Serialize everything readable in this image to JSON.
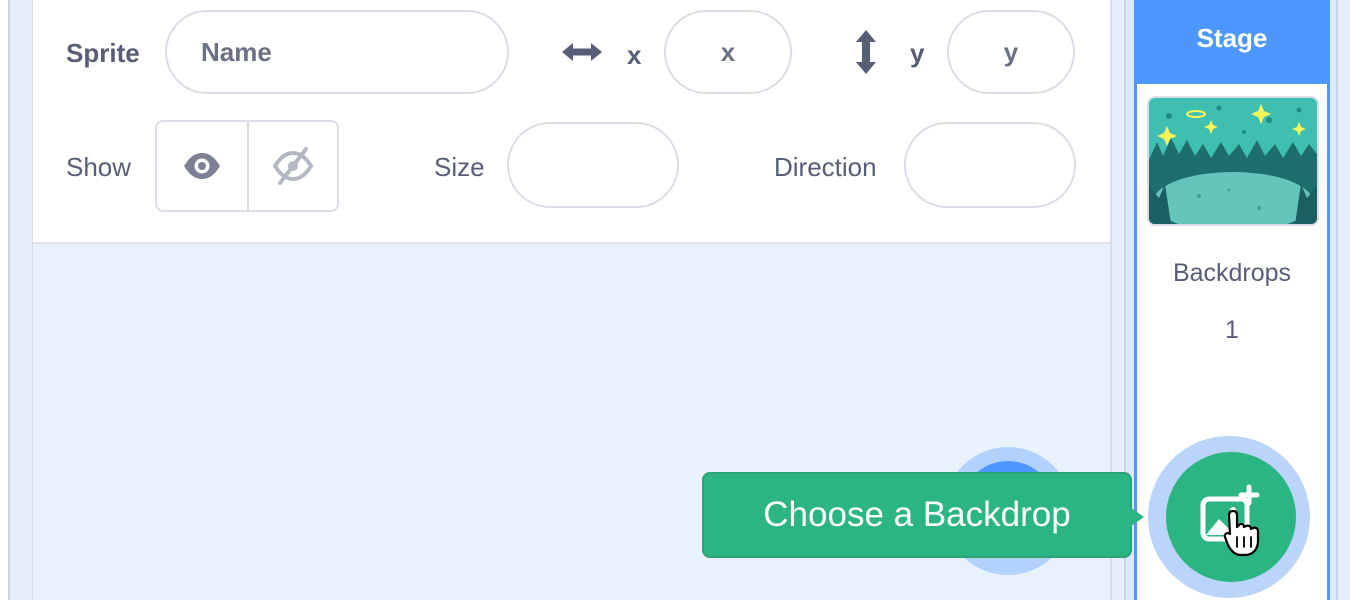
{
  "sprite_info": {
    "sprite_label": "Sprite",
    "name_placeholder": "Name",
    "x_label": "x",
    "x_placeholder": "x",
    "y_label": "y",
    "y_placeholder": "y",
    "show_label": "Show",
    "size_label": "Size",
    "direction_label": "Direction",
    "size_value": "",
    "direction_value": ""
  },
  "stage": {
    "header": "Stage",
    "backdrops_label": "Backdrops",
    "backdrops_count": "1"
  },
  "tooltip": {
    "text": "Choose a Backdrop"
  },
  "colors": {
    "accent_blue": "#4d97ff",
    "extension_green": "#2bb582",
    "text_gray": "#575e75"
  },
  "icons": {
    "x_axis": "horizontal-arrows-icon",
    "y_axis": "vertical-arrows-icon",
    "show": "eye-icon",
    "hide": "eye-slash-icon",
    "backdrop_add": "image-plus-icon",
    "cursor": "pointer-hand-icon"
  }
}
